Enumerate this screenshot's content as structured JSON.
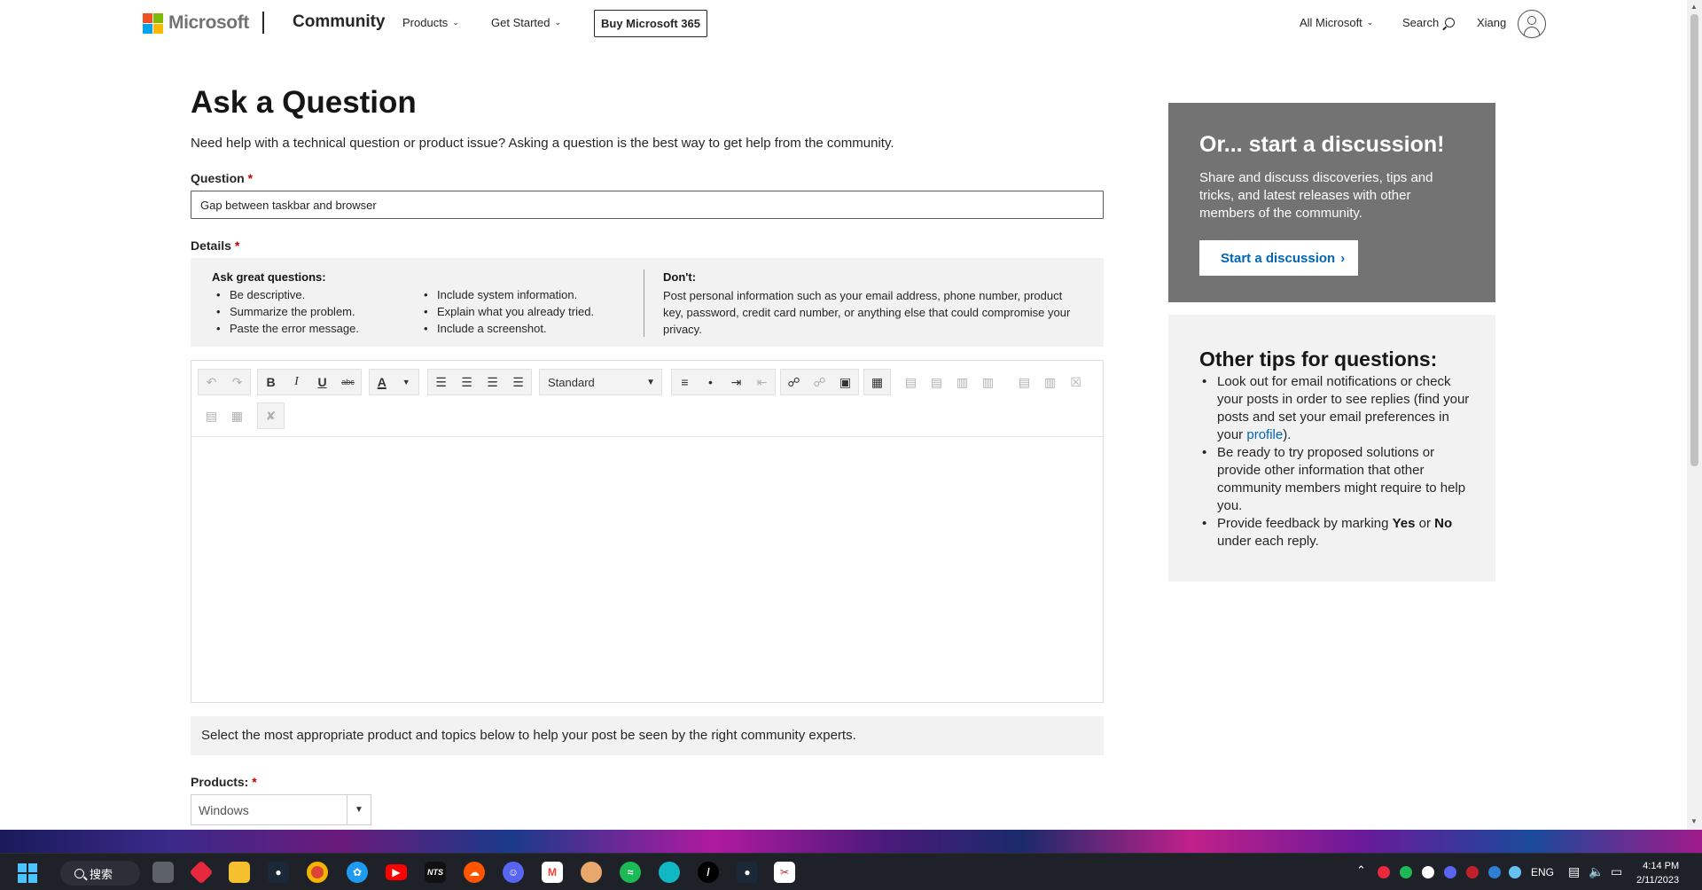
{
  "header": {
    "brand": "Microsoft",
    "section": "Community",
    "nav": [
      "Products",
      "Get Started"
    ],
    "buy_button": "Buy Microsoft 365",
    "all_microsoft": "All Microsoft",
    "search_label": "Search",
    "user_name": "Xiang"
  },
  "page": {
    "title": "Ask a Question",
    "intro": "Need help with a technical question or product issue? Asking a question is the best way to get help from the community."
  },
  "question": {
    "label": "Question",
    "required_mark": "*",
    "value": "Gap between taskbar and browser"
  },
  "details": {
    "label": "Details",
    "required_mark": "*",
    "ask_heading": "Ask great questions:",
    "ask_col1": [
      "Be descriptive.",
      "Summarize the problem.",
      "Paste the error message."
    ],
    "ask_col2": [
      "Include system information.",
      "Explain what you already tried.",
      "Include a screenshot."
    ],
    "dont_heading": "Don't:",
    "dont_text": "Post personal information such as your email address, phone number, product key, password, credit card number, or anything else that could compromise your privacy."
  },
  "editor": {
    "format_select": "Standard",
    "format_letters": {
      "bold": "B",
      "italic": "I",
      "underline": "U",
      "strike": "abc",
      "font_color": "A"
    },
    "body_value": ""
  },
  "hint": "Select the most appropriate product and topics below to help your post be seen by the right community experts.",
  "products": {
    "label": "Products:",
    "required_mark": "*",
    "value": "Windows"
  },
  "discussion_card": {
    "title": "Or... start a discussion!",
    "text": "Share and discuss discoveries, tips and tricks, and latest releases with other members of the community.",
    "button": "Start a discussion"
  },
  "tips_card": {
    "title": "Other tips for questions:",
    "tip1_before": "Look out for email notifications or check your posts in order to see replies (find your posts and set your email preferences in your ",
    "tip1_link": "profile",
    "tip1_after": ").",
    "tip2": "Be ready to try proposed solutions or provide other information that other community members might require to help you.",
    "tip3_before": "Provide feedback by marking ",
    "tip3_yes": "Yes",
    "tip3_mid": " or ",
    "tip3_no": "No",
    "tip3_after": " under each reply."
  },
  "taskbar": {
    "search_label": "搜索",
    "nts_label": "NTS",
    "language": "ENG",
    "time": "4:14 PM",
    "date": "2/11/2023",
    "colors": {
      "start": "#4cc2ff",
      "chrome": "#db4437",
      "twitter": "#1d9bf0",
      "youtube": "#ff0000",
      "soundcloud": "#ff5500",
      "discord": "#5865f2",
      "spotify": "#1db954"
    }
  }
}
